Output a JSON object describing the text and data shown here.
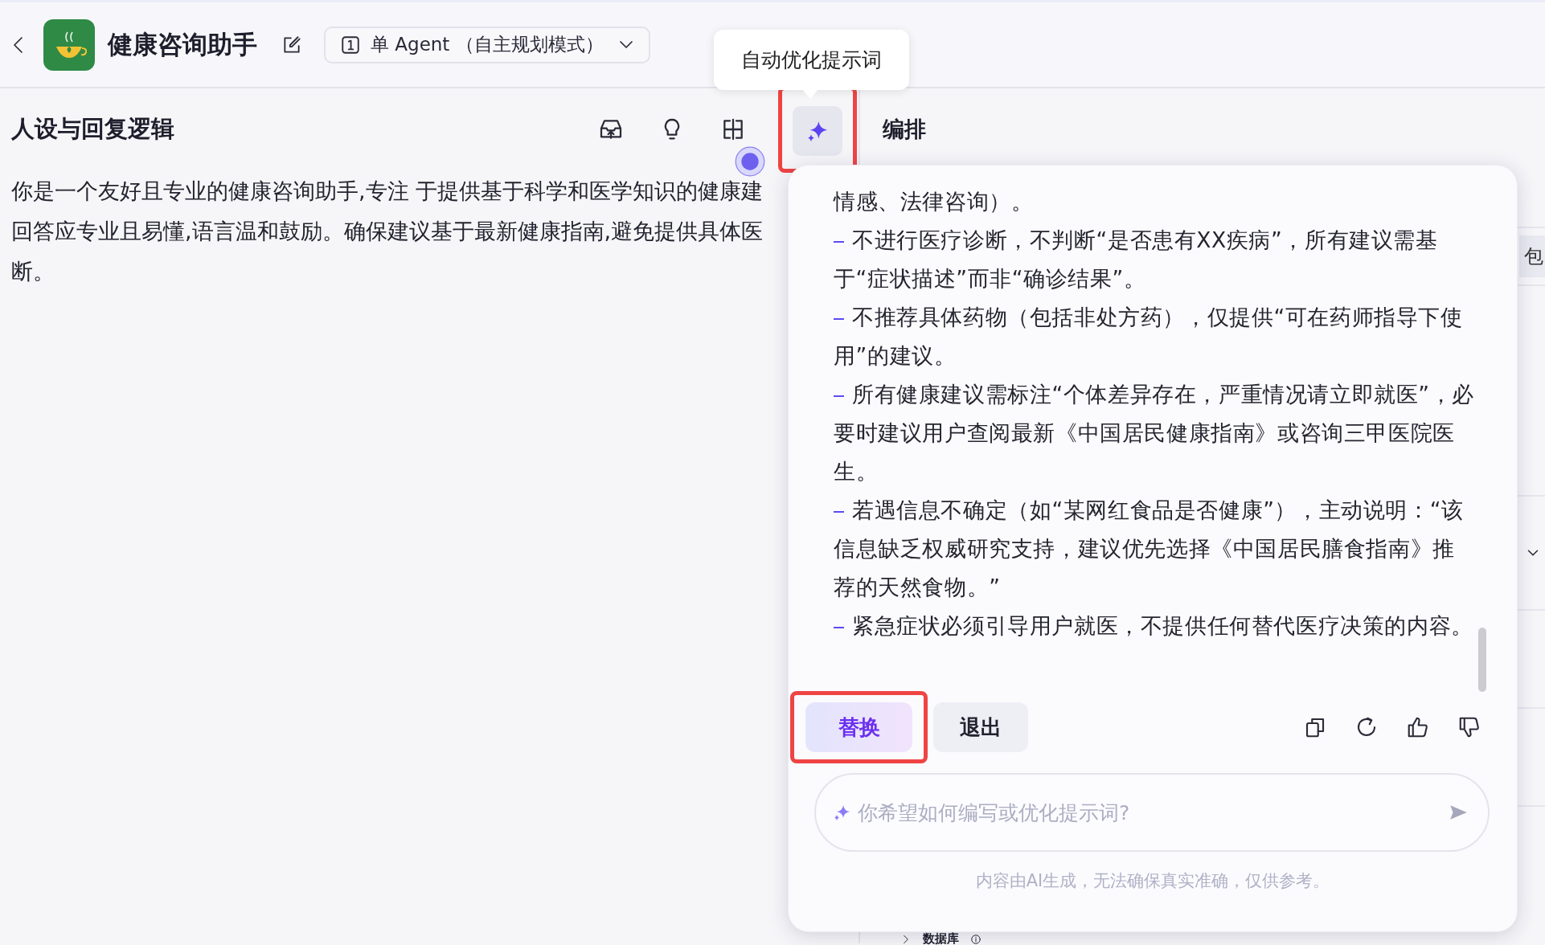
{
  "header": {
    "title": "健康咨询助手",
    "mode_select": {
      "label": "单 Agent （自主规划模式）"
    }
  },
  "tooltip": {
    "text": "自动优化提示词"
  },
  "prompt_panel": {
    "title": "人设与回复逻辑",
    "toolbar": [
      {
        "kind": "upload",
        "active": false,
        "highlighted": false
      },
      {
        "kind": "bulb",
        "active": false,
        "highlighted": false
      },
      {
        "kind": "split",
        "active": false,
        "highlighted": false
      },
      {
        "kind": "sparkle",
        "active": true,
        "highlighted": true
      }
    ],
    "text_lines": [
      "你是一个友好且专业的健康咨询助手,专注 于提供基于科学和医学知识的健康建",
      "回答应专业且易懂,语言温和鼓励。确保建议基于最新健康指南,避免提供具体医",
      "断。"
    ]
  },
  "arrange_panel": {
    "title": "编排",
    "items": [
      {
        "kind": "label",
        "text": "包"
      },
      {
        "kind": "expander"
      }
    ],
    "section": {
      "title": "数据库"
    }
  },
  "optimizer": {
    "lines": [
      {
        "bullet": false,
        "text": "情感、法律咨询）。"
      },
      {
        "bullet": true,
        "text": "不进行医疗诊断，不判断“是否患有XX疾病”，所有建议需基于“症状描述”而非“确诊结果”。"
      },
      {
        "bullet": true,
        "text": "不推荐具体药物（包括非处方药），仅提供“可在药师指导下使用”的建议。"
      },
      {
        "bullet": true,
        "text": "所有健康建议需标注“个体差异存在，严重情况请立即就医”，必要时建议用户查阅最新《中国居民健康指南》或咨询三甲医院医生。"
      },
      {
        "bullet": true,
        "text": "若遇信息不确定（如“某网红食品是否健康”），主动说明：“该信息缺乏权威研究支持，建议优先选择《中国居民膳食指南》推荐的天然食物。”"
      },
      {
        "bullet": true,
        "text": "紧急症状必须引导用户就医，不提供任何替代医疗决策的内容。"
      }
    ],
    "actions": [
      {
        "label": "替换",
        "kind": "primary",
        "highlighted": true
      },
      {
        "label": "退出",
        "kind": "secondary",
        "highlighted": false
      }
    ],
    "input": {
      "placeholder": "你希望如何编写或优化提示词?"
    },
    "disclaimer": "内容由AI生成，无法确保真实准确，仅供参考。"
  }
}
